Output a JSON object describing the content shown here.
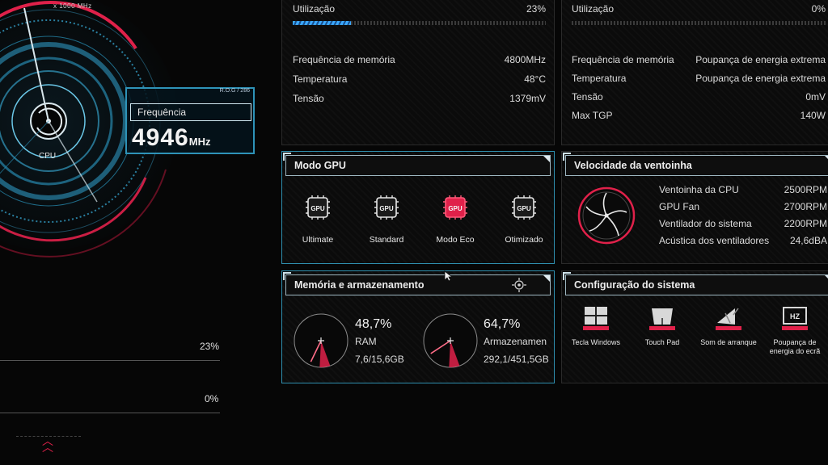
{
  "gauge": {
    "scale_label": "x 1000 MHz",
    "cpu_label": "CPU",
    "tag": "R.O.G / 286",
    "frequency_title": "Frequência",
    "frequency_value": "4946",
    "frequency_unit": "MHz",
    "pct_top": "23%",
    "pct_bottom": "0%"
  },
  "cpu_stats": {
    "utilization_label": "Utilização",
    "utilization_value": "23%",
    "utilization_fraction": 0.23,
    "rows": [
      {
        "label": "Frequência de memória",
        "value": "4800MHz"
      },
      {
        "label": "Temperatura",
        "value": "48°C"
      },
      {
        "label": "Tensão",
        "value": "1379mV"
      }
    ]
  },
  "gpu_stats": {
    "utilization_label": "Utilização",
    "utilization_value": "0%",
    "utilization_fraction": 0,
    "rows": [
      {
        "label": "Frequência de memória",
        "value": "Poupança de energia extrema"
      },
      {
        "label": "Temperatura",
        "value": "Poupança de energia extrema"
      },
      {
        "label": "Tensão",
        "value": "0mV"
      },
      {
        "label": "Max TGP",
        "value": "140W"
      }
    ]
  },
  "gpu_mode": {
    "title": "Modo GPU",
    "modes": [
      {
        "name": "Ultimate",
        "icon": "gpu-ultimate-icon",
        "active": false
      },
      {
        "name": "Standard",
        "icon": "gpu-standard-icon",
        "active": false
      },
      {
        "name": "Modo Eco",
        "icon": "gpu-eco-icon",
        "active": true
      },
      {
        "name": "Otimizado",
        "icon": "gpu-optimized-icon",
        "active": false
      }
    ],
    "chip_text": "GPU"
  },
  "fan_speed": {
    "title": "Velocidade da ventoinha",
    "rows": [
      {
        "label": "Ventoinha da CPU",
        "value": "2500RPM"
      },
      {
        "label": "GPU Fan",
        "value": "2700RPM"
      },
      {
        "label": "Ventilador do sistema",
        "value": "2200RPM"
      },
      {
        "label": "Acústica dos ventiladores",
        "value": "24,6dBA"
      }
    ]
  },
  "memory_storage": {
    "title": "Memória e armazenamento",
    "ram": {
      "percent": "48,7%",
      "percent_fraction": 0.487,
      "label": "RAM",
      "detail": "7,6/15,6GB"
    },
    "storage": {
      "percent": "64,7%",
      "percent_fraction": 0.647,
      "label": "Armazenamen",
      "detail": "292,1/451,5GB"
    }
  },
  "system_config": {
    "title": "Configuração do sistema",
    "items": [
      {
        "label": "Tecla Windows",
        "icon": "windows-key-icon"
      },
      {
        "label": "Touch Pad",
        "icon": "touchpad-icon"
      },
      {
        "label": "Som de arranque",
        "icon": "boot-sound-icon"
      },
      {
        "label": "Poupança de energia do ecrã",
        "icon": "panel-power-saver-icon"
      }
    ],
    "hz_text": "HZ"
  },
  "colors": {
    "accent_red": "#e0214a",
    "teal": "#2f8fae",
    "blue": "#3aa7ff"
  }
}
